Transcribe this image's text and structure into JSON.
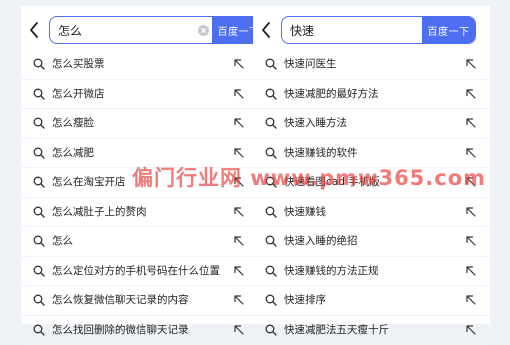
{
  "colors": {
    "accent": "#4e6ef2",
    "page_bg": "#eef1f6",
    "watermark": "#eb3c3c"
  },
  "left_panel": {
    "query": "怎么",
    "search_button": "百度一下",
    "suggestions": [
      {
        "text": "怎么买股票"
      },
      {
        "text": "怎么开微店"
      },
      {
        "text": "怎么瘦脸"
      },
      {
        "text": "怎么减肥"
      },
      {
        "text": "怎么在淘宝开店"
      },
      {
        "text": "怎么减肚子上的赘肉"
      },
      {
        "text": "怎么"
      },
      {
        "text": "怎么定位对方的手机号码在什么位置"
      },
      {
        "text": "怎么恢复微信聊天记录的内容"
      },
      {
        "text": "怎么找回删除的微信聊天记录"
      }
    ]
  },
  "right_panel": {
    "query": "快速",
    "search_button": "百度一下",
    "suggestions": [
      {
        "text": "快速问医生"
      },
      {
        "text": "快速减肥的最好方法"
      },
      {
        "text": "快速入睡方法"
      },
      {
        "text": "快速赚钱的软件"
      },
      {
        "text": "快速看图cad 手机版"
      },
      {
        "text": "快速赚钱"
      },
      {
        "text": "快速入睡的绝招"
      },
      {
        "text": "快速赚钱的方法正规"
      },
      {
        "text": "快速排序"
      },
      {
        "text": "快速减肥法五天瘦十斤"
      }
    ]
  },
  "icons": {
    "back": "chevron-left-icon",
    "clear": "clear-circle-icon",
    "search": "search-icon",
    "fill": "arrow-up-left-icon"
  },
  "watermark": "偏门行业网 www.pmw365.com"
}
